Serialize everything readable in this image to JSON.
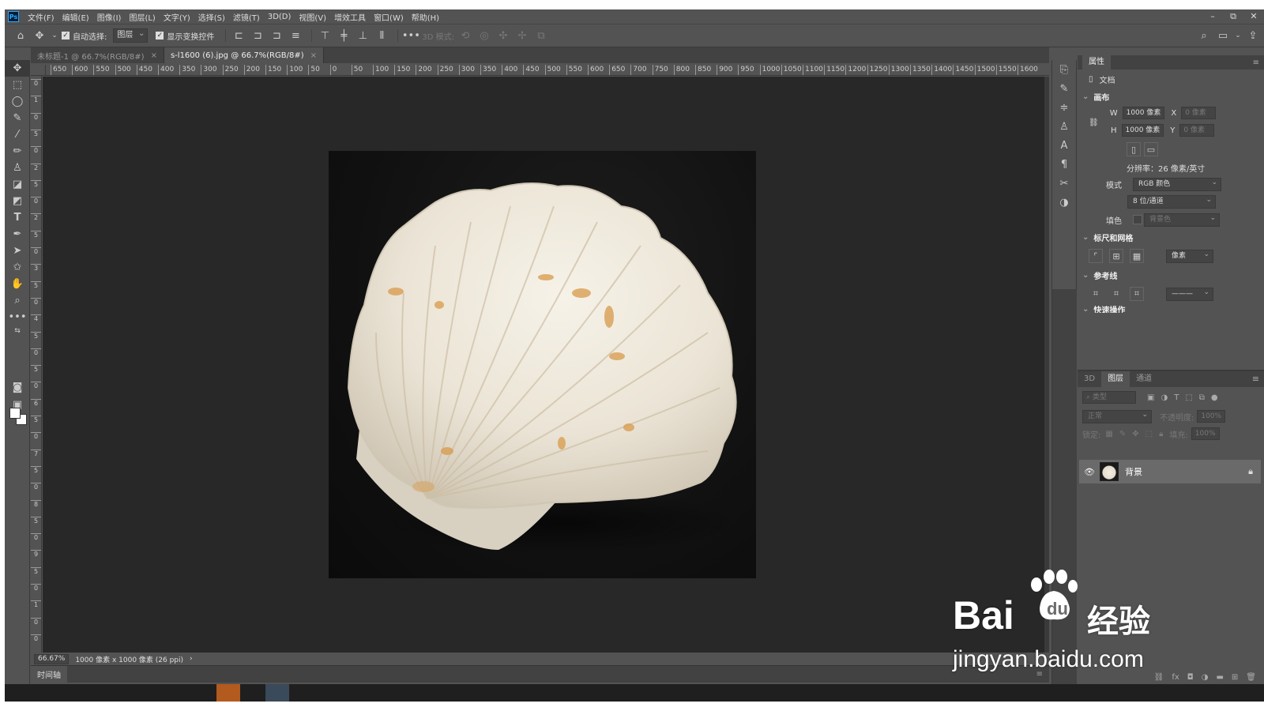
{
  "menubar": {
    "logo": "Ps",
    "items": [
      "文件(F)",
      "编辑(E)",
      "图像(I)",
      "图层(L)",
      "文字(Y)",
      "选择(S)",
      "滤镜(T)",
      "3D(D)",
      "视图(V)",
      "增效工具",
      "窗口(W)",
      "帮助(H)"
    ],
    "window_controls": [
      "–",
      "⧉",
      "✕"
    ]
  },
  "options_bar": {
    "auto_select_label": "自动选择:",
    "auto_select_target": "图层",
    "show_transform_label": "显示变换控件",
    "mode_3d_label": "3D 模式:"
  },
  "tabs": [
    {
      "label": "未标题-1 @ 66.7%(RGB/8#)",
      "close": "×"
    },
    {
      "label": "s-l1600 (6).jpg @ 66.7%(RGB/8#)",
      "close": "×"
    }
  ],
  "ruler": {
    "h_ticks": [
      "650",
      "600",
      "550",
      "500",
      "450",
      "400",
      "350",
      "300",
      "250",
      "200",
      "150",
      "100",
      "50",
      "0",
      "50",
      "100",
      "150",
      "200",
      "250",
      "300",
      "350",
      "400",
      "450",
      "500",
      "550",
      "600",
      "650",
      "700",
      "750",
      "800",
      "850",
      "900",
      "950",
      "1000",
      "1050",
      "1100",
      "1150",
      "1200",
      "1250",
      "1300",
      "1350",
      "1400",
      "1450",
      "1500",
      "1550",
      "1600"
    ],
    "v_ticks": [
      "0",
      "1",
      "0",
      "5",
      "0",
      "2",
      "5",
      "0",
      "2",
      "5",
      "0",
      "3",
      "5",
      "0",
      "4",
      "5",
      "0",
      "5",
      "0",
      "6",
      "5",
      "0",
      "7",
      "5",
      "0",
      "8",
      "5",
      "0",
      "9",
      "5",
      "0",
      "1",
      "0",
      "0"
    ]
  },
  "status": {
    "zoom": "66.67%",
    "doc_info": "1000 像素 x 1000 像素 (26 ppi)",
    "arrow": "›"
  },
  "timeline": {
    "label": "时间轴",
    "menu": "≡"
  },
  "properties": {
    "panel_title": "属性",
    "doc_label": "文档",
    "canvas_title": "画布",
    "w_label": "W",
    "w_value": "1000 像素",
    "x_label": "X",
    "x_value": "0 像素",
    "h_label": "H",
    "h_value": "1000 像素",
    "y_label": "Y",
    "y_value": "0 像素",
    "resolution": "分辨率：26 像素/英寸",
    "mode_label": "模式",
    "mode_value": "RGB 颜色",
    "depth_value": "8 位/通道",
    "fill_label": "填色",
    "fill_value": "背景色",
    "rulers_title": "标尺和网格",
    "unit_value": "像素",
    "guides_title": "参考线",
    "quick_actions": "快速操作"
  },
  "layers_panel": {
    "tabs": [
      "3D",
      "图层",
      "通道"
    ],
    "kind_placeholder": "类型",
    "blend_mode": "正常",
    "opacity_label": "不透明度:",
    "opacity_value": "100%",
    "lock_label": "锁定:",
    "fill_label": "填充:",
    "fill_value": "100%",
    "layer_name": "背景"
  },
  "watermark": {
    "brand_left": "Bai",
    "brand_right": "经验",
    "url": "jingyan.baidu.com"
  },
  "colors": {
    "ui_bg": "#535353",
    "canvas_bg": "#282828",
    "accent": "#31a8ff"
  }
}
